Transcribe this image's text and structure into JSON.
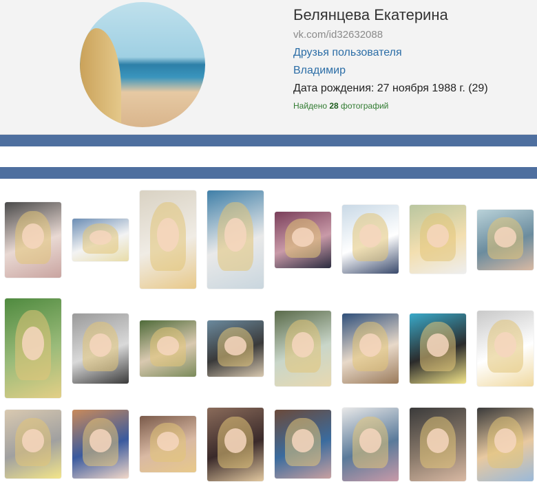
{
  "profile": {
    "name": "Белянцева Екатерина",
    "url": "vk.com/id32632088",
    "friends_link": "Друзья пользователя",
    "city_link": "Владимир",
    "birthdate": "Дата рождения: 27 ноября 1988 г. (29)",
    "found_prefix": "Найдено ",
    "found_count": "28",
    "found_suffix": " фотографий"
  },
  "colors": {
    "accent_stripe": "#4e6f9f",
    "link": "#2b6da6",
    "found_text": "#2f7a2f"
  },
  "photos": [
    {
      "colors": [
        "#4a4a4a",
        "#c9a4a0",
        "#e9d9d3"
      ]
    },
    {
      "colors": [
        "#6b8db4",
        "#e8dca8",
        "#f3f3f3"
      ]
    },
    {
      "colors": [
        "#d9d2c3",
        "#e8c98a",
        "#f0ece5"
      ]
    },
    {
      "colors": [
        "#3f7fa8",
        "#c9d6de",
        "#e9e9e9"
      ]
    },
    {
      "colors": [
        "#7a3f5a",
        "#2b2b3f",
        "#c99aa8"
      ]
    },
    {
      "colors": [
        "#c9d9e6",
        "#39496b",
        "#ffffff"
      ]
    },
    {
      "colors": [
        "#b9c6a0",
        "#eeeeee",
        "#f3dfb0"
      ]
    },
    {
      "colors": [
        "#b9d2d9",
        "#d9b9a3",
        "#6b8c9e"
      ]
    },
    {
      "colors": [
        "#4f8a3f",
        "#e3cf86",
        "#9abb7a"
      ]
    },
    {
      "colors": [
        "#9a9a9a",
        "#3a3a3a",
        "#d9d9d9"
      ]
    },
    {
      "colors": [
        "#4f6b3a",
        "#7a8a5a",
        "#d9c9b0"
      ]
    },
    {
      "colors": [
        "#6b8a9e",
        "#d9c9b0",
        "#3a3a3a"
      ]
    },
    {
      "colors": [
        "#5a6b4a",
        "#e8d9b0",
        "#c9d6c9"
      ]
    },
    {
      "colors": [
        "#2f4f7a",
        "#9a7a5a",
        "#e8d9c9"
      ]
    },
    {
      "colors": [
        "#39a9c9",
        "#f3e58a",
        "#2b2b2b"
      ]
    },
    {
      "colors": [
        "#c9c9c9",
        "#f0d9a0",
        "#ffffff"
      ]
    },
    {
      "colors": [
        "#d9c9b0",
        "#f3e58a",
        "#a0a0a0"
      ]
    },
    {
      "colors": [
        "#c98a5a",
        "#f3d9c9",
        "#3a5a9e"
      ]
    },
    {
      "colors": [
        "#7a5a4a",
        "#e8c98a",
        "#d9b9a3"
      ]
    },
    {
      "colors": [
        "#8a6b5a",
        "#e3c9a0",
        "#3a2a2a"
      ]
    },
    {
      "colors": [
        "#6b4a3a",
        "#c9a0a0",
        "#3a6b9e"
      ]
    },
    {
      "colors": [
        "#e8e8e8",
        "#c99aa8",
        "#5a7a9a"
      ]
    },
    {
      "colors": [
        "#3a3a3a",
        "#d9b9a3",
        "#8a7a6b"
      ]
    },
    {
      "colors": [
        "#3a3a3a",
        "#9ab9d9",
        "#e8c9a0"
      ]
    }
  ]
}
